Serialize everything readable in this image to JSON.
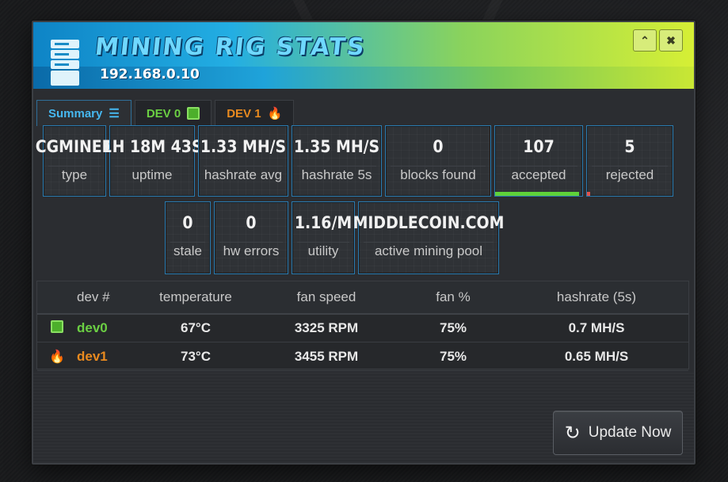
{
  "window": {
    "title": "MINING RIG STATS",
    "ip": "192.168.0.10",
    "min_icon": "chevron-up",
    "close_icon": "close-circle"
  },
  "tabs": [
    {
      "label": "Summary",
      "icon": "list-icon",
      "color": "#46b7ef",
      "active": true
    },
    {
      "label": "DEV 0",
      "icon": "chip-icon",
      "color": "#6bcf43",
      "active": false
    },
    {
      "label": "DEV 1",
      "icon": "flame-icon",
      "color": "#e98a1f",
      "active": false
    }
  ],
  "stats_row1": [
    {
      "value": "CGMINER",
      "label": "type"
    },
    {
      "value": "1H 18M 43S",
      "label": "uptime"
    },
    {
      "value": "1.33 MH/S",
      "label": "hashrate avg"
    },
    {
      "value": "1.35 MH/S",
      "label": "hashrate 5s"
    },
    {
      "value": "0",
      "label": "blocks found"
    },
    {
      "value": "107",
      "label": "accepted",
      "bar_color": "#5fd13a",
      "bar_fraction": 0.96
    },
    {
      "value": "5",
      "label": "rejected",
      "bar_color": "#e0504a",
      "bar_fraction": 0.04
    }
  ],
  "stats_row2": [
    {
      "value": "0",
      "label": "stale"
    },
    {
      "value": "0",
      "label": "hw errors"
    },
    {
      "value": "1.16/M",
      "label": "utility"
    },
    {
      "value": "MIDDLECOIN.COM",
      "label": "active mining pool"
    }
  ],
  "table": {
    "headers": [
      "",
      "dev #",
      "temperature",
      "fan speed",
      "fan %",
      "hashrate (5s)"
    ],
    "rows": [
      {
        "icon": "chip-icon",
        "dev": "dev0",
        "temperature": "67°C",
        "fan_speed": "3325 RPM",
        "fan_pct": "75%",
        "hashrate": "0.7 MH/S"
      },
      {
        "icon": "flame-icon",
        "dev": "dev1",
        "temperature": "73°C",
        "fan_speed": "3455 RPM",
        "fan_pct": "75%",
        "hashrate": "0.65 MH/S"
      }
    ]
  },
  "footer": {
    "update_label": "Update Now",
    "update_icon": "refresh-icon"
  }
}
